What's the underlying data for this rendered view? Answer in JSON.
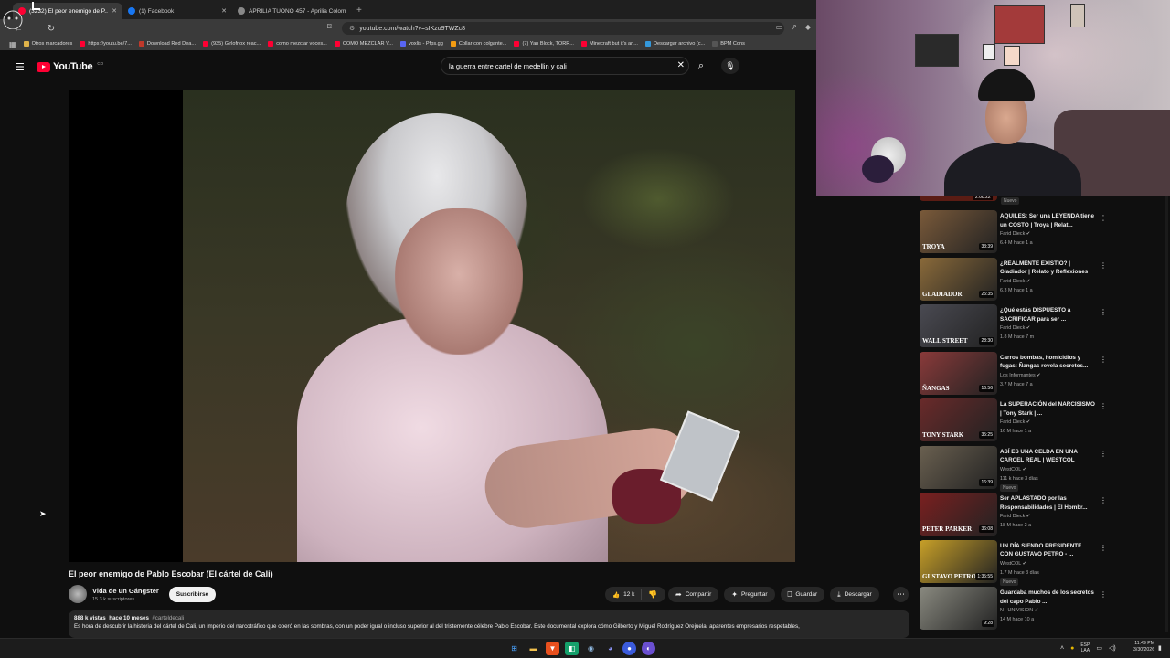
{
  "browser": {
    "tabs": [
      {
        "title": "(3232) El peor enemigo de P...",
        "favicon_color": "#ff0033",
        "active": true
      },
      {
        "title": "(1) Facebook",
        "favicon_color": "#1877f2",
        "active": false
      },
      {
        "title": "APRILIA TUONO 457 - Aprilia Colom...",
        "favicon_color": "#888888",
        "active": false
      }
    ],
    "new_tab": "+",
    "url": "youtube.com/watch?v=sIKzo9TWZc8",
    "bookmarks": [
      {
        "label": "Otros marcadores",
        "color": "#e0b34a"
      },
      {
        "label": "https://youtu.be/7...",
        "color": "#ff0033"
      },
      {
        "label": "Download Red Dea...",
        "color": "#c0392b"
      },
      {
        "label": "(935) Girlofnox reac...",
        "color": "#ff0033"
      },
      {
        "label": "como mezclar voces...",
        "color": "#ff0033"
      },
      {
        "label": "COMO MEZCLAR V...",
        "color": "#ff0033"
      },
      {
        "label": "voxlis - Pfps.gg",
        "color": "#5865f2"
      },
      {
        "label": "Collar con colgante...",
        "color": "#f39c12"
      },
      {
        "label": "(7) Yan Block, TORR...",
        "color": "#ff0033"
      },
      {
        "label": "Minecraft but it's an...",
        "color": "#ff0033"
      },
      {
        "label": "Descargar archivo (c...",
        "color": "#3498db"
      },
      {
        "label": "BPM Cons",
        "color": "#555555"
      }
    ]
  },
  "youtube": {
    "logo_text": "YouTube",
    "country_code": "CO",
    "search_query": "la guerra entre cartel de medellin y cali",
    "video": {
      "title": "El peor enemigo de Pablo Escobar (El cártel de Cali)",
      "channel": "Vida de un Gángster",
      "subscribers": "15.3 k suscriptores",
      "subscribe_label": "Suscribirse",
      "likes": "12 k",
      "share_label": "Compartir",
      "ask_label": "Preguntar",
      "save_label": "Guardar",
      "download_label": "Descargar",
      "views": "888 k vistas",
      "age": "hace 10 meses",
      "hashtag": "#carteldecali",
      "description": "Es hora de descubrir la historia del cártel de Cali, un imperio del narcotráfico que operó en las sombras, con un poder igual o incluso superior al del tristemente célebre Pablo Escobar. Este documental explora cómo Gilberto y Miguel Rodríguez Orejuela, aparentes empresarios respetables,"
    },
    "top_partial": {
      "duration": "2:08:22",
      "badge": "Nuevo"
    },
    "recommendations": [
      {
        "title": "AQUILES: Ser una LEYENDA tiene un COSTO | Troya | Relat...",
        "channel": "Farid Dieck",
        "stats": "6.4 M  hace 1 a",
        "duration": "33:39",
        "thumb": "#7a5a3a",
        "badge": ""
      },
      {
        "title": "¿REALMENTE EXISTIÓ? | Gladiador | Relato y Reflexiones",
        "channel": "Farid Dieck",
        "stats": "6.3 M  hace 1 a",
        "duration": "25:35",
        "thumb": "#8a6a3a",
        "badge": ""
      },
      {
        "title": "¿Qué estás DISPUESTO a SACRIFICAR para ser ...",
        "channel": "Farid Dieck",
        "stats": "1.8 M  hace 7 m",
        "duration": "28:30",
        "thumb": "#4a4a52",
        "badge": ""
      },
      {
        "title": "Carros bombas, homicidios y fugas: Ñangas revela secretos...",
        "channel": "Los Informantes",
        "stats": "3.7 M  hace 7 a",
        "duration": "16:56",
        "thumb": "#8a3a3a",
        "badge": ""
      },
      {
        "title": "La SUPERACIÓN del NARCISISMO | Tony Stark | ...",
        "channel": "Farid Dieck",
        "stats": "16 M  hace 1 a",
        "duration": "35:25",
        "thumb": "#6a2a2a",
        "badge": ""
      },
      {
        "title": "ASÍ ES UNA CELDA EN UNA CARCEL REAL | WESTCOL",
        "channel": "WestCOL",
        "stats": "111 k  hace 3 días",
        "duration": "16:39",
        "thumb": "#6a6050",
        "badge": "Nuevo"
      },
      {
        "title": "Ser APLASTADO por las Responsabilidades | El Hombr...",
        "channel": "Farid Dieck",
        "stats": "18 M  hace 2 a",
        "duration": "36:08",
        "thumb": "#7a2020",
        "badge": ""
      },
      {
        "title": "UN DÍA SIENDO PRESIDENTE CON GUSTAVO PETRO - ...",
        "channel": "WestCOL",
        "stats": "1.7 M  hace 3 días",
        "duration": "1:35:55",
        "thumb": "#c8a028",
        "badge": "Nuevo"
      },
      {
        "title": "Guardaba muchos de los secretos del capo Pablo ...",
        "channel": "N+ UNIVISION",
        "stats": "14 M  hace 10 a",
        "duration": "9:28",
        "thumb": "#8a8a80",
        "badge": ""
      }
    ],
    "thumb_labels": [
      "TROYA",
      "GLADIADOR",
      "WALL STREET",
      "ÑANGAS",
      "TONY STARK",
      "",
      "PETER PARKER",
      "GUSTAVO PETRO",
      ""
    ]
  },
  "taskbar": {
    "lang": "ESP",
    "lang2": "LAA",
    "time": "11:49 PM",
    "date": "3/30/2026"
  }
}
